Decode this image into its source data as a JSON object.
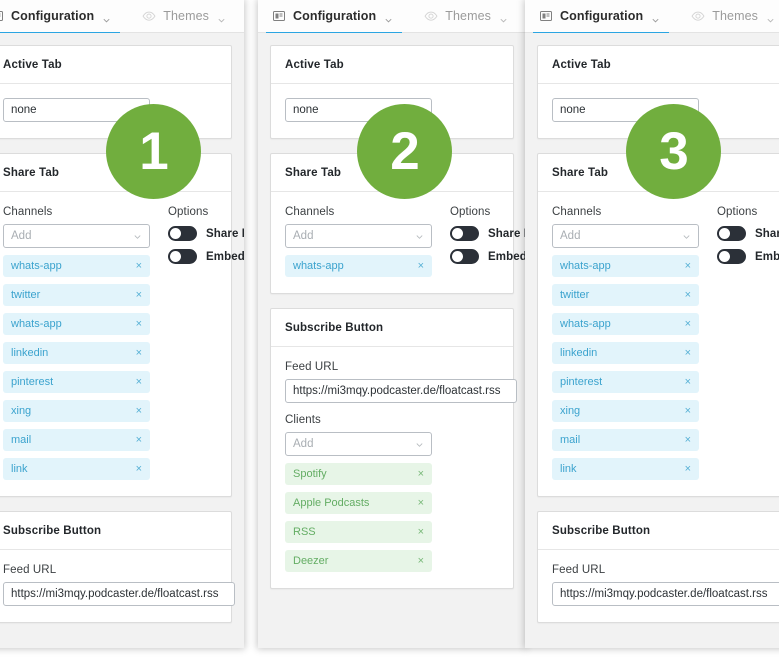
{
  "tabs": [
    {
      "icon": "configuration-icon",
      "label": "Configuration",
      "active": true,
      "caret": true
    },
    {
      "icon": "eye-icon",
      "label": "Themes",
      "active": false,
      "caret": true
    },
    {
      "icon": "document-icon",
      "label": "",
      "active": false,
      "caret": false
    }
  ],
  "cards": {
    "active_tab": {
      "title": "Active Tab",
      "select_value": "none"
    },
    "share_tab": {
      "title": "Share Tab",
      "channels_label": "Channels",
      "channels_placeholder": "Add",
      "options_label": "Options",
      "toggles": [
        {
          "label": "Share Page",
          "on": false
        },
        {
          "label": "Embed",
          "on": false
        }
      ],
      "channels_full": [
        "whats-app",
        "twitter",
        "whats-app",
        "linkedin",
        "pinterest",
        "xing",
        "mail",
        "link"
      ],
      "channels_single": [
        "whats-app"
      ]
    },
    "subscribe_button": {
      "title": "Subscribe Button",
      "feed_url_label": "Feed URL",
      "feed_url_value": "https://mi3mqy.podcaster.de/floatcast.rss",
      "clients_label": "Clients",
      "clients_placeholder": "Add",
      "clients": [
        "Spotify",
        "Apple Podcasts",
        "RSS",
        "Deezer"
      ]
    }
  },
  "badges": [
    {
      "number": "1"
    },
    {
      "number": "2"
    },
    {
      "number": "3"
    }
  ],
  "colors": {
    "badge_green": "#71ae3e",
    "tab_active_underline": "#2aa5e2",
    "chip_blue_bg": "#e2f4fb",
    "chip_blue_text": "#3ba3ce",
    "chip_green_bg": "#e7f5e7",
    "chip_green_text": "#64ad64",
    "toggle_track": "#2b3038",
    "panel_bg": "#f2f2f2"
  },
  "remove_glyph": "×"
}
